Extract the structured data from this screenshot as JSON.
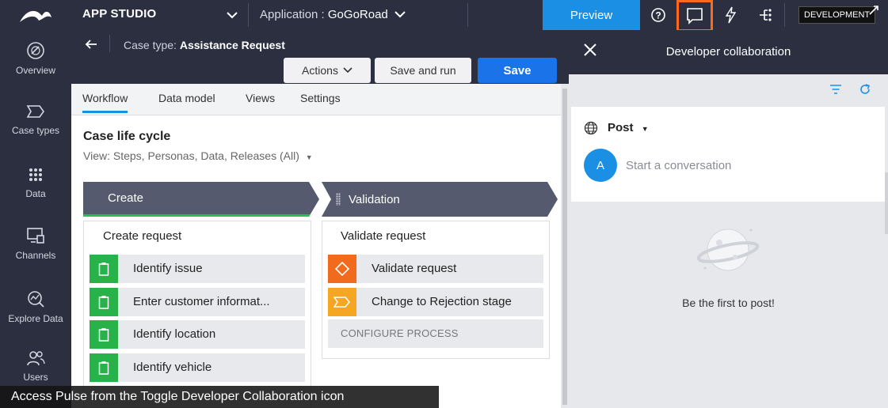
{
  "topbar": {
    "app_name": "APP STUDIO",
    "application_label": "Application :",
    "application_value": "GoGoRoad",
    "preview_label": "Preview",
    "environment_badge": "DEVELOPMENT"
  },
  "leftnav": {
    "items": [
      {
        "label": "Overview",
        "icon": "gauge-icon"
      },
      {
        "label": "Case types",
        "icon": "chevron-tag-icon"
      },
      {
        "label": "Data",
        "icon": "grid-dots-icon"
      },
      {
        "label": "Channels",
        "icon": "monitor-icon"
      },
      {
        "label": "Explore Data",
        "icon": "explore-chart-icon"
      },
      {
        "label": "Users",
        "icon": "users-icon"
      }
    ]
  },
  "header": {
    "case_type_label": "Case type:",
    "case_type_value": "Assistance Request",
    "actions_label": "Actions",
    "save_and_run_label": "Save and run",
    "save_label": "Save"
  },
  "tabs": [
    {
      "label": "Workflow",
      "active": true
    },
    {
      "label": "Data model"
    },
    {
      "label": "Views"
    },
    {
      "label": "Settings"
    }
  ],
  "lifecycle": {
    "title": "Case life cycle",
    "view_text": "View: Steps, Personas, Data, Releases (All)"
  },
  "stages": [
    {
      "name": "Create",
      "process": "Create request",
      "steps": [
        {
          "label": "Identify issue",
          "icon": "clipboard-icon"
        },
        {
          "label": "Enter customer informat...",
          "icon": "clipboard-icon"
        },
        {
          "label": "Identify location",
          "icon": "clipboard-icon"
        },
        {
          "label": "Identify vehicle",
          "icon": "clipboard-icon"
        }
      ]
    },
    {
      "name": "Validation",
      "process": "Validate request",
      "steps": [
        {
          "label": "Validate request",
          "icon": "decision-diamond-icon"
        },
        {
          "label": "Change to Rejection stage",
          "icon": "change-stage-icon"
        }
      ],
      "configure_label": "CONFIGURE PROCESS"
    }
  ],
  "panel": {
    "title": "Developer collaboration",
    "post_label": "Post",
    "avatar_initial": "A",
    "placeholder": "Start a conversation",
    "empty_text": "Be the first to post!"
  },
  "caption": "Access Pulse from the Toggle Developer Collaboration icon",
  "colors": {
    "dark_bg": "#2b2f40",
    "accent_blue": "#1a8fe3",
    "save_blue": "#1a73e8",
    "green_step": "#27b34a",
    "orange_step": "#f26b1d",
    "yellow_step": "#f5a623",
    "highlight": "#ff6a1a"
  }
}
